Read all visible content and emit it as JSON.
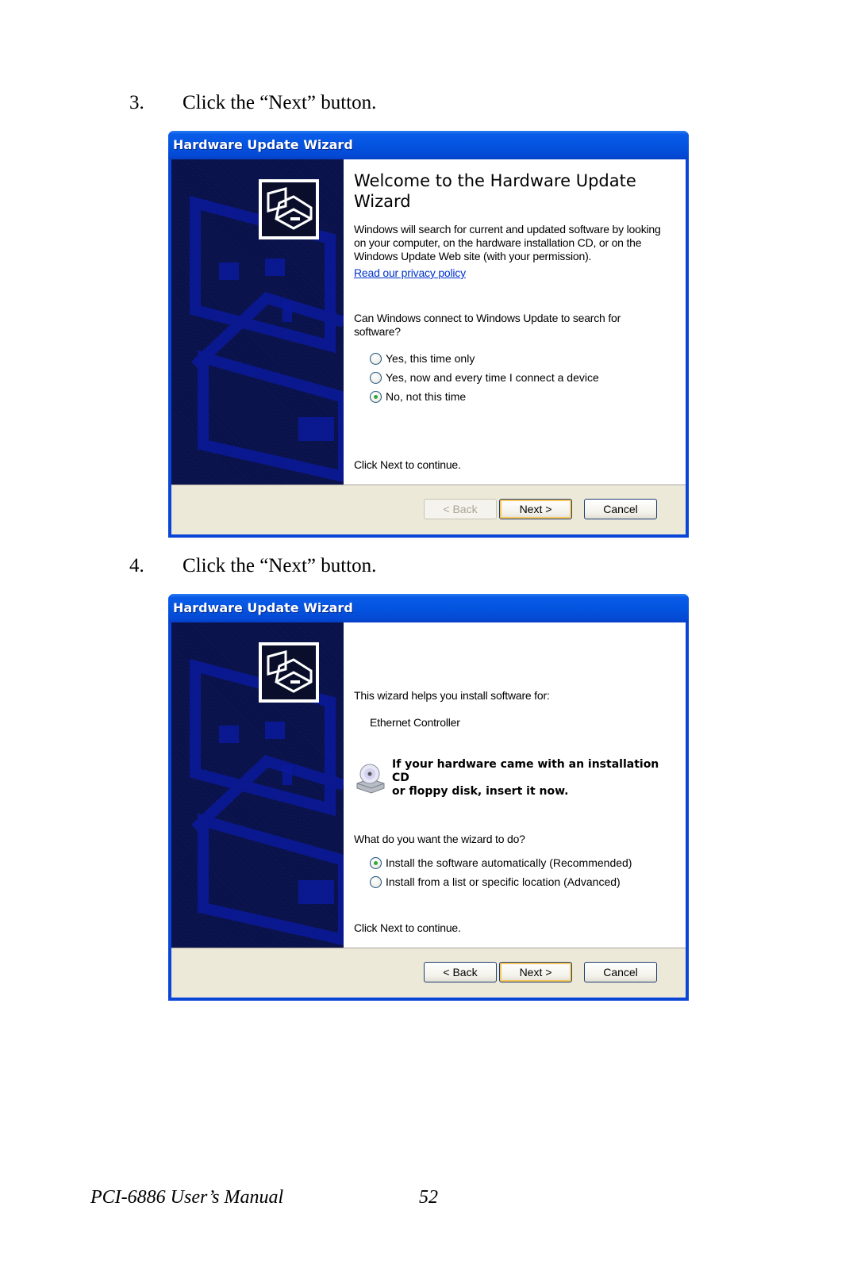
{
  "steps": [
    {
      "number": "3.",
      "text": "Click the “Next” button."
    },
    {
      "number": "4.",
      "text": "Click the “Next” button."
    }
  ],
  "dialog1": {
    "title": "Hardware Update Wizard",
    "heading": "Welcome to the Hardware Update Wizard",
    "intro": "Windows will search for current and updated software by looking on your computer, on the hardware installation CD, or on the Windows Update Web site (with your permission).",
    "privacy_link": "Read our privacy policy",
    "question": "Can Windows connect to Windows Update to search for software?",
    "options": [
      {
        "label": "Yes, this time only",
        "checked": false
      },
      {
        "label": "Yes, now and every time I connect a device",
        "checked": false
      },
      {
        "label": "No, not this time",
        "checked": true
      }
    ],
    "continue_text": "Click Next to continue.",
    "buttons": {
      "back": "< Back",
      "next": "Next >",
      "cancel": "Cancel",
      "back_enabled": false
    }
  },
  "dialog2": {
    "title": "Hardware Update Wizard",
    "intro": "This wizard helps you install software for:",
    "device": "Ethernet Controller",
    "cd_note_line1": "If your hardware came with an installation CD",
    "cd_note_line2": "or floppy disk, insert it now.",
    "question": "What do you want the wizard to do?",
    "options": [
      {
        "label": "Install the software automatically (Recommended)",
        "checked": true
      },
      {
        "label": "Install from a list or specific location (Advanced)",
        "checked": false
      }
    ],
    "continue_text": "Click Next to continue.",
    "buttons": {
      "back": "< Back",
      "next": "Next >",
      "cancel": "Cancel",
      "back_enabled": true
    }
  },
  "footer": {
    "manual_title": "PCI-6886 User’s Manual",
    "page_number": "52"
  }
}
